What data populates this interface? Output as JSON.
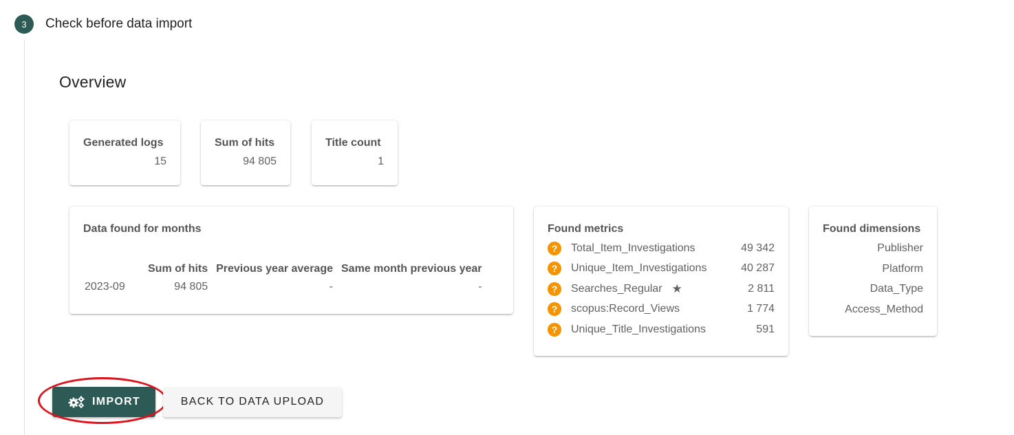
{
  "step": {
    "number": "3",
    "title": "Check before data import"
  },
  "overview": {
    "title": "Overview"
  },
  "stats": [
    {
      "label": "Generated logs",
      "value": "15"
    },
    {
      "label": "Sum of hits",
      "value": "94 805"
    },
    {
      "label": "Title count",
      "value": "1"
    }
  ],
  "months": {
    "title": "Data found for months",
    "columns": [
      "Sum of hits",
      "Previous year average",
      "Same month previous year"
    ],
    "rows": [
      {
        "month": "2023-09",
        "sum": "94 805",
        "prev_avg": "-",
        "same_month": "-"
      }
    ]
  },
  "metrics": {
    "title": "Found metrics",
    "items": [
      {
        "name": "Total_Item_Investigations",
        "value": "49 342",
        "icon": "question-icon"
      },
      {
        "name": "Unique_Item_Investigations",
        "value": "40 287",
        "icon": "question-icon"
      },
      {
        "name": "Searches_Regular",
        "value": "2 811",
        "icon": "question-icon",
        "starred": true
      },
      {
        "name": "scopus:Record_Views",
        "value": "1 774",
        "icon": "question-icon"
      },
      {
        "name": "Unique_Title_Investigations",
        "value": "591",
        "icon": "question-icon"
      }
    ]
  },
  "dimensions": {
    "title": "Found dimensions",
    "items": [
      "Publisher",
      "Platform",
      "Data_Type",
      "Access_Method"
    ]
  },
  "actions": {
    "import_label": "Import",
    "back_label": "Back to data upload"
  },
  "colors": {
    "primary": "#2d5a54",
    "warning": "#f59300",
    "highlight": "#e0111a"
  }
}
